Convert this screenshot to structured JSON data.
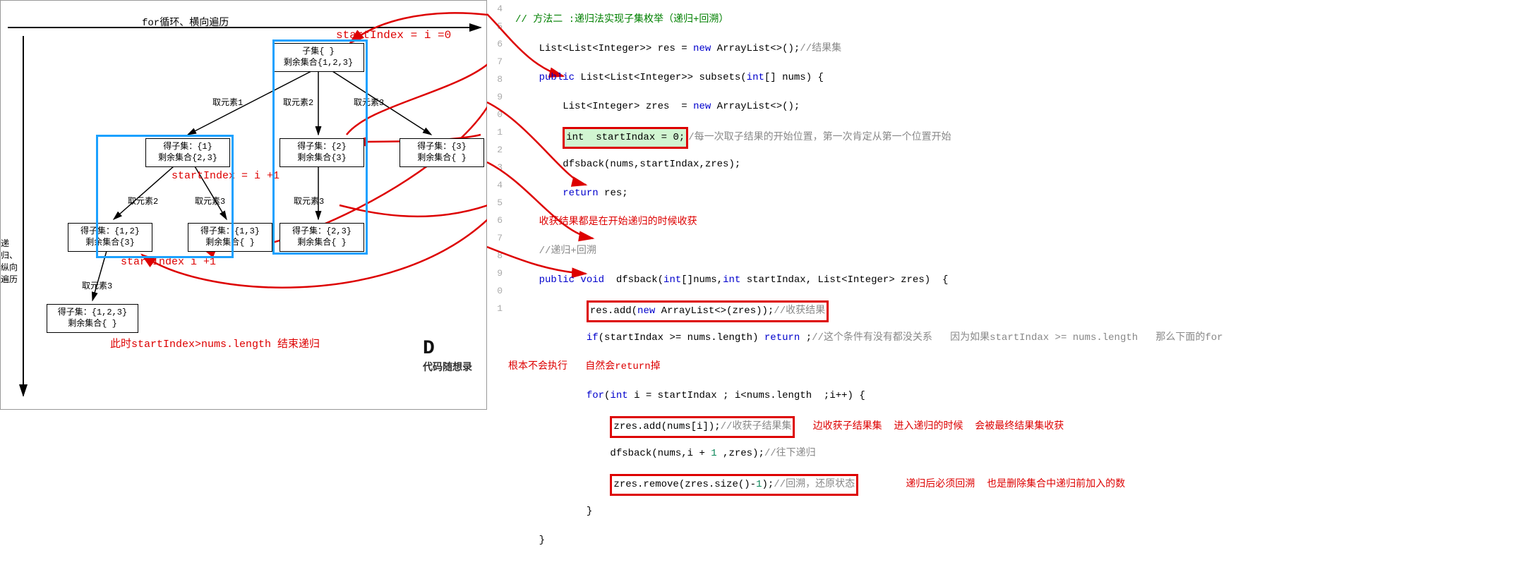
{
  "diagram": {
    "top_label": "for循环、横向遍历",
    "left_label": "递归、纵向遍历",
    "annot_start0": "startIndex = i =0",
    "annot_starti1a": "startIndex = i +1",
    "annot_starti1b": "startIndex i +1",
    "annot_end": "此时startIndex>nums.length   结束递归",
    "root": {
      "l1": "子集{ }",
      "l2": "剩余集合{1,2,3}"
    },
    "n1": {
      "l1": "得子集：{1}",
      "l2": "剩余集合{2,3}"
    },
    "n2": {
      "l1": "得子集：{2}",
      "l2": "剩余集合{3}"
    },
    "n3": {
      "l1": "得子集：{3}",
      "l2": "剩余集合{ }"
    },
    "n12": {
      "l1": "得子集：{1,2}",
      "l2": "剩余集合{3}"
    },
    "n13": {
      "l1": "得子集：{1,3}",
      "l2": "剩余集合{ }"
    },
    "n23": {
      "l1": "得子集：{2,3}",
      "l2": "剩余集合{ }"
    },
    "n123": {
      "l1": "得子集：{1,2,3}",
      "l2": "剩余集合{ }"
    },
    "edge_e1": "取元素1",
    "edge_e2": "取元素2",
    "edge_e3": "取元素3",
    "watermark": "代码随想录"
  },
  "code": {
    "lines": [
      "4",
      "5",
      "6",
      "7",
      "8",
      "9",
      "0",
      "1",
      "2",
      "3",
      "4",
      "5",
      "6",
      "7",
      "8",
      "9",
      "0",
      "1"
    ],
    "c4": "// 方法二 :递归法实现子集枚举（递归+回溯）",
    "c5_a": "List<List<Integer>> res = ",
    "c5_b": "new",
    "c5_c": " ArrayList<>();",
    "c5_d": "//结果集",
    "c6_a": "public",
    "c6_b": " List<List<Integer>> subsets(",
    "c6_c": "int",
    "c6_d": "[] nums) {",
    "c7_a": "List<Integer> zres  = ",
    "c7_b": "new",
    "c7_c": " ArrayList<>();",
    "c8_box": "int  startIndax = 0;",
    "c8_cm": "/每一次取子结果的开始位置，第一次肯定从第一个位置开始",
    "c9": "dfsback(nums,startIndax,zres);",
    "c10_a": "return",
    "c10_b": " res;",
    "c11_ann": "收获结果都是在开始递归的时候收获",
    "c12_cm": "//递归+回溯",
    "c13_a": "public void",
    "c13_b": "  dfsback(",
    "c13_c": "int",
    "c13_d": "[]nums,",
    "c13_e": "int",
    "c13_f": " startIndax, List<Integer> zres)  {",
    "c14_box_a": "res.add(",
    "c14_box_b": "new",
    "c14_box_c": " ArrayList<>(zres));",
    "c14_cm": "//收获结果",
    "c15_a": "if",
    "c15_b": "(startIndax >= nums.length) ",
    "c15_c": "return",
    "c15_d": " ;",
    "c15_cm": "//这个条件有没有都没关系   因为如果startIndax >= nums.length   那么下面的for",
    "c15_ann": "根本不会执行   自然会return掉",
    "c16_a": "for",
    "c16_b": "(",
    "c16_c": "int",
    "c16_d": " i = startIndax ; i<nums.length  ;i++) {",
    "c17_box": "zres.add(nums[i]);",
    "c17_cm": "//收获子结果集",
    "c17_ann": "边收获子结果集  进入递归的时候  会被最终结果集收获",
    "c18_a": "dfsback(nums,i + ",
    "c18_b": "1",
    "c18_c": " ,zres);",
    "c18_cm": "//往下递归",
    "c19_box_a": "zres.remove(zres.size()-",
    "c19_box_b": "1",
    "c19_box_c": ");",
    "c19_cm": "//回溯，还原状态",
    "c19_ann": "递归后必须回溯  也是删除集合中递归前加入的数",
    "c20": "}",
    "c21": "}"
  }
}
